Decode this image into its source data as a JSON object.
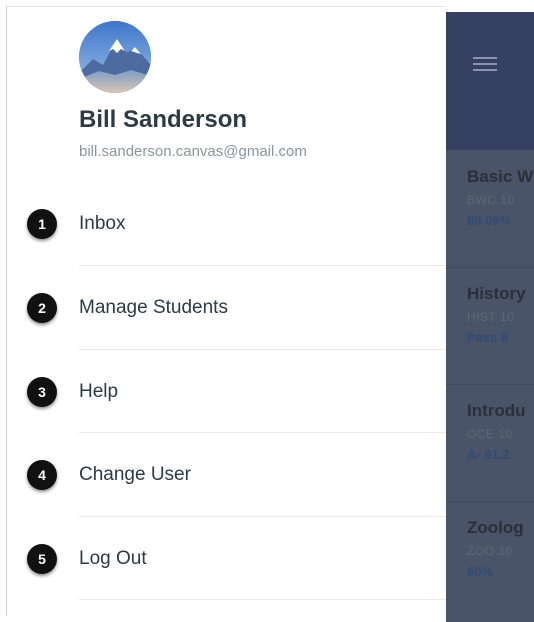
{
  "user": {
    "name": "Bill Sanderson",
    "email": "bill.sanderson.canvas@gmail.com",
    "avatar_icon": "mountain-avatar"
  },
  "menu": {
    "items": [
      {
        "number": "1",
        "label": "Inbox"
      },
      {
        "number": "2",
        "label": "Manage Students"
      },
      {
        "number": "3",
        "label": "Help"
      },
      {
        "number": "4",
        "label": "Change User"
      },
      {
        "number": "5",
        "label": "Log Out"
      }
    ]
  },
  "background_app": {
    "menu_icon": "hamburger-icon",
    "courses": [
      {
        "title": "Basic W",
        "code": "BWC 10",
        "grade": "89.09%"
      },
      {
        "title": "History",
        "code": "HIST 10",
        "grade": "Pass  8"
      },
      {
        "title": "Introdu",
        "code": "OCE 10",
        "grade": "A-  91.2"
      },
      {
        "title": "Zoolog",
        "code": "ZOO 10",
        "grade": "60%"
      }
    ]
  },
  "colors": {
    "drawer_bg": "#ffffff",
    "text_primary": "#2d3b45",
    "text_secondary": "#8b969e",
    "badge_bg": "#111111",
    "navbar_bg": "#354063",
    "overlay_bg": "#4a5468"
  }
}
